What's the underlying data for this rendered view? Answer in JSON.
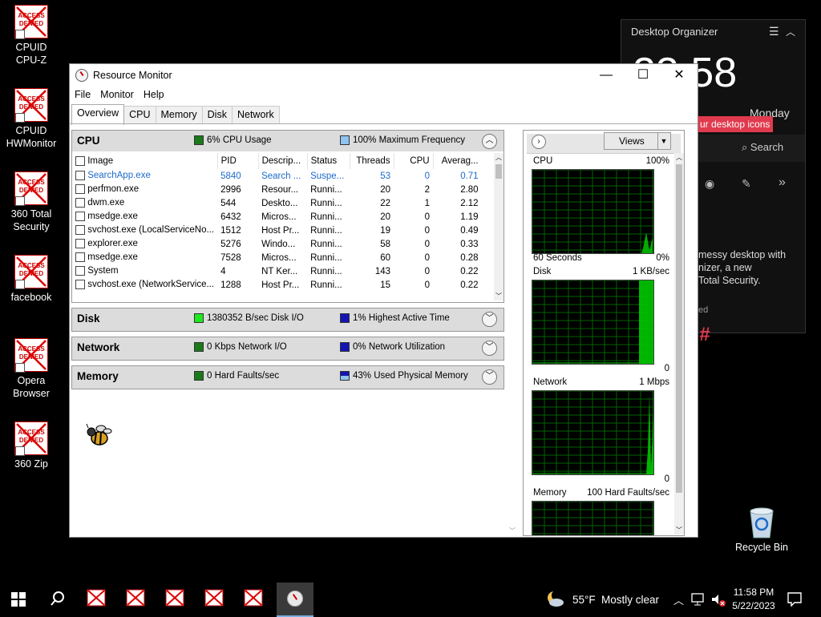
{
  "desktop": {
    "icons": [
      {
        "label_line1": "CPUID",
        "label_line2": "CPU-Z",
        "icon": "access-denied-icon"
      },
      {
        "label_line1": "CPUID",
        "label_line2": "HWMonitor",
        "icon": "access-denied-icon"
      },
      {
        "label_line1": "360 Total",
        "label_line2": "Security",
        "icon": "access-denied-icon"
      },
      {
        "label_line1": "facebook",
        "label_line2": "",
        "icon": "access-denied-icon"
      },
      {
        "label_line1": "Opera",
        "label_line2": "Browser",
        "icon": "access-denied-icon"
      },
      {
        "label_line1": "360 Zip",
        "label_line2": "",
        "icon": "access-denied-icon"
      }
    ],
    "access_denied_text_1": "ACCESS",
    "access_denied_text_2": "DENIED",
    "recycle_bin": "Recycle Bin"
  },
  "organizer": {
    "title": "Desktop Organizer",
    "clock": "23:58",
    "day": "Monday",
    "banner": "ur desktop icons",
    "search": "Search",
    "text1": "messy desktop with",
    "text2": "nizer, a new",
    "text3": "Total Security.",
    "text4": "ed",
    "hash": "#"
  },
  "window": {
    "title": "Resource Monitor",
    "menu": [
      "File",
      "Monitor",
      "Help"
    ],
    "tabs": [
      "Overview",
      "CPU",
      "Memory",
      "Disk",
      "Network"
    ],
    "cpu": {
      "title": "CPU",
      "usage": "6% CPU Usage",
      "freq": "100% Maximum Frequency",
      "columns": [
        "Image",
        "PID",
        "Descrip...",
        "Status",
        "Threads",
        "CPU",
        "Averag..."
      ],
      "rows": [
        {
          "image": "SearchApp.exe",
          "pid": "5840",
          "desc": "Search ...",
          "status": "Suspe...",
          "threads": "53",
          "cpu": "0",
          "avg": "0.71",
          "blue": true
        },
        {
          "image": "perfmon.exe",
          "pid": "2996",
          "desc": "Resour...",
          "status": "Runni...",
          "threads": "20",
          "cpu": "2",
          "avg": "2.80",
          "blue": false
        },
        {
          "image": "dwm.exe",
          "pid": "544",
          "desc": "Deskto...",
          "status": "Runni...",
          "threads": "22",
          "cpu": "1",
          "avg": "2.12",
          "blue": false
        },
        {
          "image": "msedge.exe",
          "pid": "6432",
          "desc": "Micros...",
          "status": "Runni...",
          "threads": "20",
          "cpu": "0",
          "avg": "1.19",
          "blue": false
        },
        {
          "image": "svchost.exe (LocalServiceNo...",
          "pid": "1512",
          "desc": "Host Pr...",
          "status": "Runni...",
          "threads": "19",
          "cpu": "0",
          "avg": "0.49",
          "blue": false
        },
        {
          "image": "explorer.exe",
          "pid": "5276",
          "desc": "Windo...",
          "status": "Runni...",
          "threads": "58",
          "cpu": "0",
          "avg": "0.33",
          "blue": false
        },
        {
          "image": "msedge.exe",
          "pid": "7528",
          "desc": "Micros...",
          "status": "Runni...",
          "threads": "60",
          "cpu": "0",
          "avg": "0.28",
          "blue": false
        },
        {
          "image": "System",
          "pid": "4",
          "desc": "NT Ker...",
          "status": "Runni...",
          "threads": "143",
          "cpu": "0",
          "avg": "0.22",
          "blue": false
        },
        {
          "image": "svchost.exe (NetworkService...",
          "pid": "1288",
          "desc": "Host Pr...",
          "status": "Runni...",
          "threads": "15",
          "cpu": "0",
          "avg": "0.22",
          "blue": false
        }
      ]
    },
    "disk": {
      "title": "Disk",
      "io": "1380352 B/sec Disk I/O",
      "active": "1% Highest Active Time"
    },
    "network": {
      "title": "Network",
      "io": "0 Kbps Network I/O",
      "util": "0% Network Utilization"
    },
    "memory": {
      "title": "Memory",
      "faults": "0 Hard Faults/sec",
      "used": "43% Used Physical Memory"
    },
    "graphs": {
      "views": "Views",
      "cpu_label": "CPU",
      "cpu_max": "100%",
      "cpu_time": "60 Seconds",
      "cpu_min": "0%",
      "disk_label": "Disk",
      "disk_max": "1 KB/sec",
      "disk_min": "0",
      "net_label": "Network",
      "net_max": "1 Mbps",
      "net_min": "0",
      "mem_label": "Memory",
      "mem_max": "100 Hard Faults/sec"
    }
  },
  "taskbar": {
    "weather_temp": "55°F",
    "weather_desc": "Mostly clear",
    "time": "11:58 PM",
    "date": "5/22/2023"
  },
  "colors": {
    "graph_green": "#00c800",
    "graph_grid": "#006400",
    "accent_blue": "#1e6ac8",
    "banner_red": "#e03a4e"
  }
}
